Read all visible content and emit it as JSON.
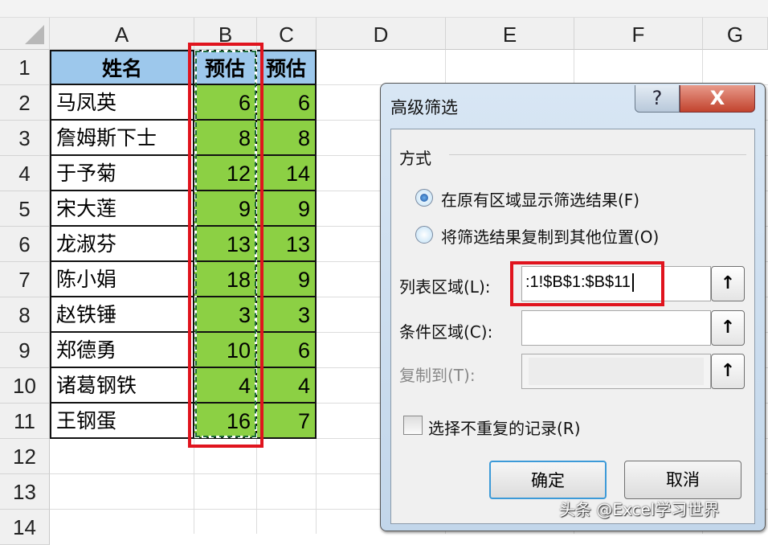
{
  "columns": [
    "A",
    "B",
    "C",
    "D",
    "E",
    "F",
    "G"
  ],
  "rows": [
    "1",
    "2",
    "3",
    "4",
    "5",
    "6",
    "7",
    "8",
    "9",
    "10",
    "11",
    "12",
    "13",
    "14"
  ],
  "table": {
    "headers": [
      "姓名",
      "预估",
      "预估"
    ],
    "names": [
      "马凤英",
      "詹姆斯下士",
      "于予菊",
      "宋大莲",
      "龙淑芬",
      "陈小娟",
      "赵铁锤",
      "郑德勇",
      "诸葛钢铁",
      "王钢蛋"
    ],
    "b": [
      "6",
      "8",
      "12",
      "9",
      "13",
      "18",
      "3",
      "10",
      "4",
      "16"
    ],
    "c": [
      "6",
      "8",
      "14",
      "9",
      "13",
      "9",
      "3",
      "6",
      "4",
      "7"
    ]
  },
  "dialog": {
    "title": "高级筛选",
    "help": "?",
    "close": "X",
    "group_label": "方式",
    "radio_in_place": "在原有区域显示筛选结果(F)",
    "radio_copy": "将筛选结果复制到其他位置(O)",
    "radio_selected": "in_place",
    "list_range_label": "列表区域(L):",
    "list_range_value": ":1!$B$1:$B$11",
    "criteria_label": "条件区域(C):",
    "criteria_value": "",
    "copy_to_label": "复制到(T):",
    "unique_label": "选择不重复的记录(R)",
    "unique_checked": false,
    "ok": "确定",
    "cancel": "取消",
    "collapse_icon": "↑"
  },
  "watermark": "头条 @Excel学习世界",
  "colors": {
    "header_fill": "#9dc8ec",
    "value_fill": "#8cd044",
    "highlight": "#e0141e"
  }
}
